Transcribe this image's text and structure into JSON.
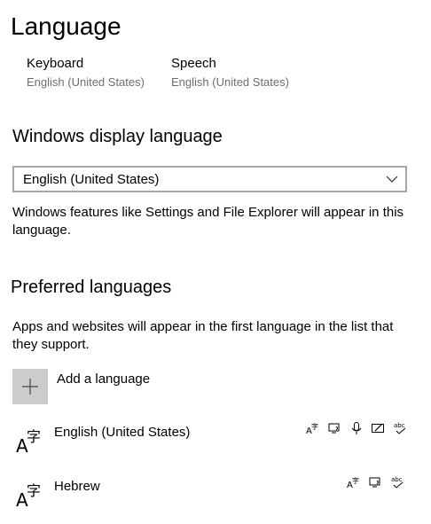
{
  "page": {
    "title": "Language"
  },
  "quick": {
    "keyboard": {
      "label": "Keyboard",
      "value": "English (United States)"
    },
    "speech": {
      "label": "Speech",
      "value": "English (United States)"
    }
  },
  "display_language": {
    "heading": "Windows display language",
    "selected": "English (United States)",
    "description": "Windows features like Settings and File Explorer will appear in this language."
  },
  "preferred": {
    "heading": "Preferred languages",
    "description": "Apps and websites will appear in the first language in the list that they support.",
    "add_label": "Add a language",
    "languages": [
      {
        "name": "English (United States)",
        "features": [
          "display-language-icon",
          "text-to-speech-icon",
          "speech-recognition-icon",
          "handwriting-icon",
          "spell-check-icon"
        ]
      },
      {
        "name": "Hebrew",
        "features": [
          "display-language-icon",
          "text-to-speech-icon",
          "spell-check-icon"
        ]
      }
    ]
  }
}
